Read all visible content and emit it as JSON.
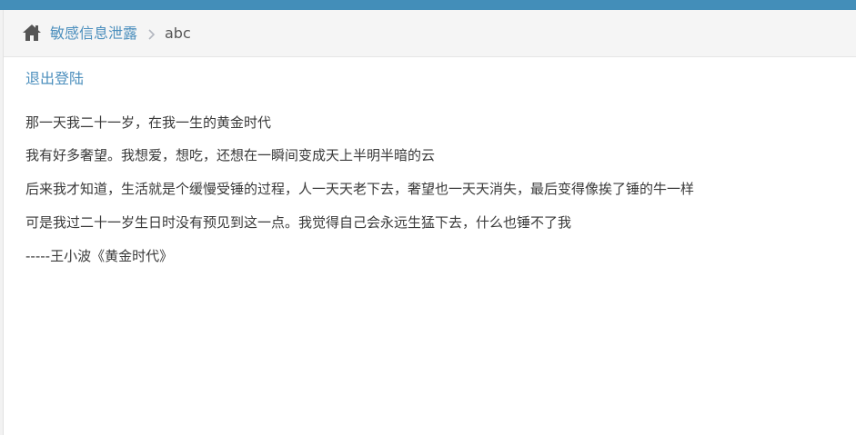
{
  "breadcrumb": {
    "home_icon": "home-icon",
    "link_label": "敏感信息泄露",
    "separator_icon": "chevron-right-icon",
    "current_label": "abc"
  },
  "logout": {
    "label": "退出登陆"
  },
  "poem": {
    "lines": [
      "那一天我二十一岁，在我一生的黄金时代",
      "我有好多奢望。我想爱，想吃，还想在一瞬间变成天上半明半暗的云",
      "后来我才知道，生活就是个缓慢受锤的过程，人一天天老下去，奢望也一天天消失，最后变得像挨了锤的牛一样",
      "可是我过二十一岁生日时没有预见到这一点。我觉得自己会永远生猛下去，什么也锤不了我",
      "-----王小波《黄金时代》"
    ]
  },
  "colors": {
    "top_bar": "#438eb9",
    "link": "#4c8fbd",
    "text": "#393939",
    "breadcrumb_bg": "#f5f5f5"
  }
}
